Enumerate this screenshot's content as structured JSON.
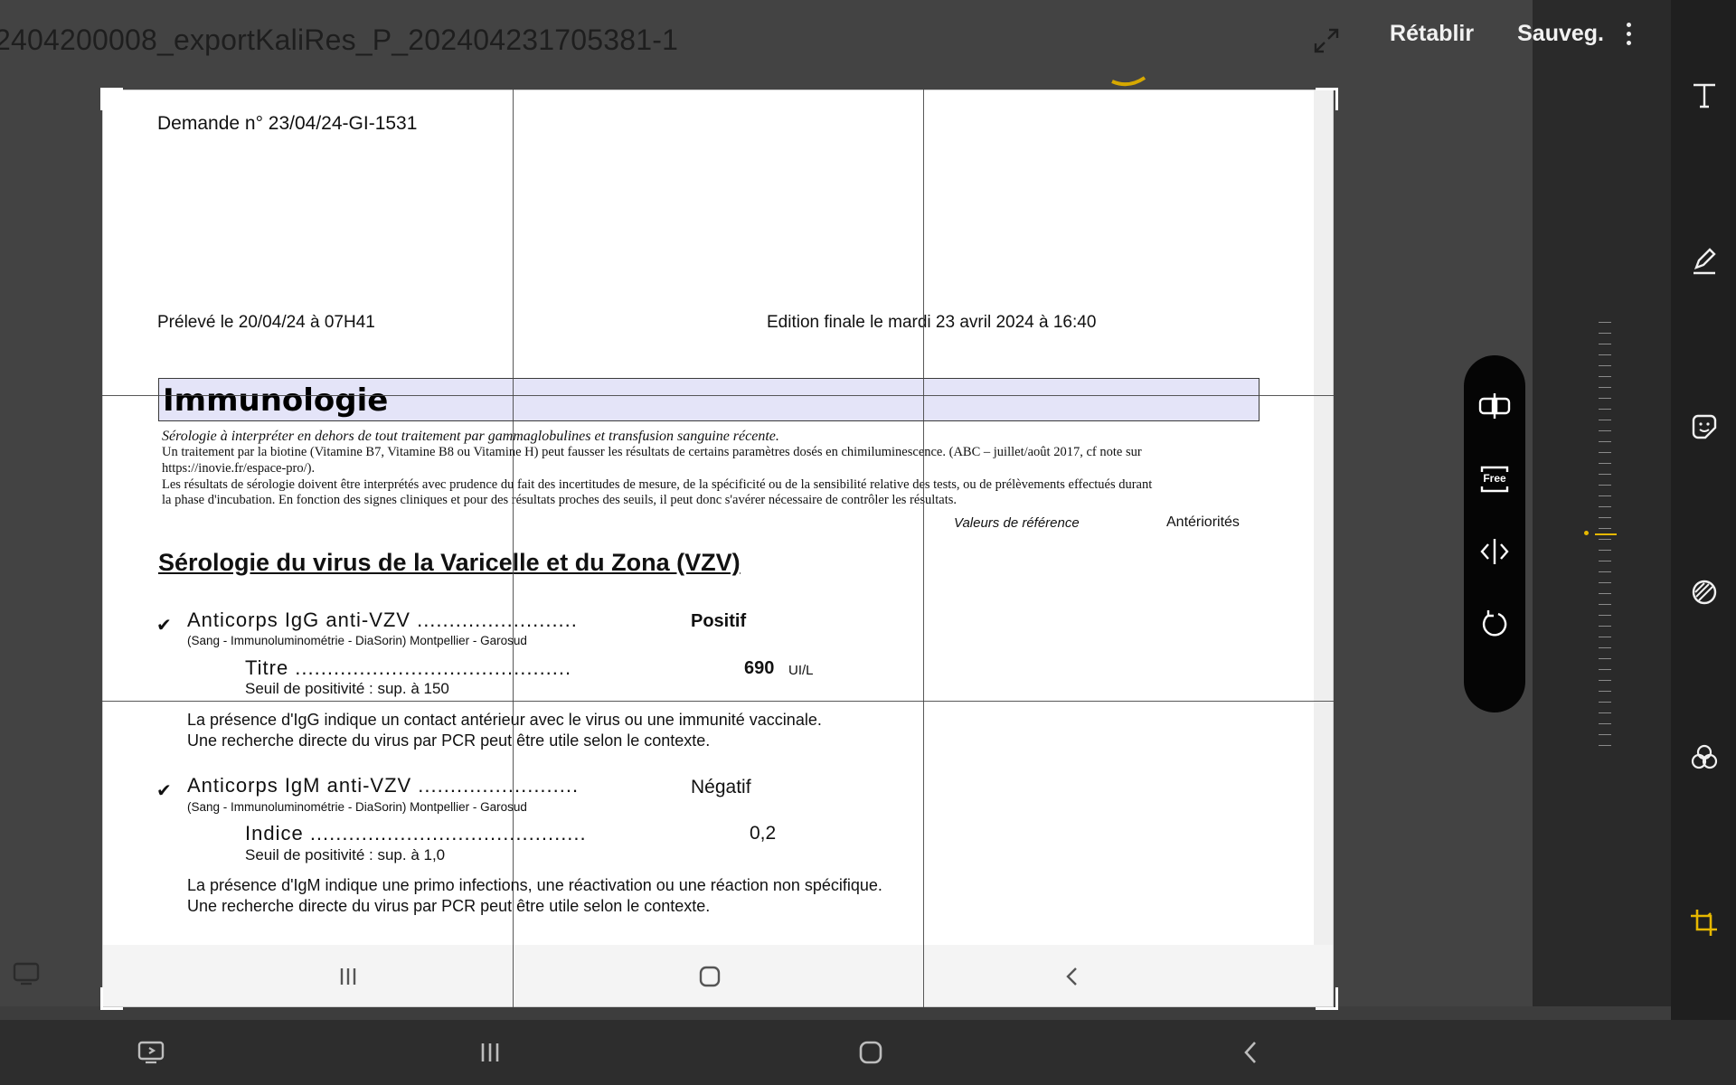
{
  "header": {
    "file_title": "2404200008_exportKaliRes_P_202404231705381-1",
    "restore_label": "Rétablir",
    "save_label": "Sauveg."
  },
  "document": {
    "request_no": "Demande n° 23/04/24-GI-1531",
    "sampled": "Prélevé le 20/04/24 à 07H41",
    "edition": "Edition finale le mardi 23 avril 2024 à 16:40",
    "section": "Immunologie",
    "note_italic": "Sérologie à interpréter en dehors de tout traitement par gammaglobulines et transfusion sanguine récente.",
    "note_line1": "Un traitement par la biotine (Vitamine B7, Vitamine B8 ou Vitamine H) peut fausser les résultats de certains paramètres dosés en chimiluminescence. (ABC – juillet/août 2017, cf note sur",
    "note_line2": "https://inovie.fr/espace-pro/).",
    "note_line3": "Les résultats de sérologie doivent être interprétés avec prudence du fait des incertitudes de mesure, de la spécificité ou de la sensibilité relative des tests, ou de prélèvements effectués durant",
    "note_line4": "la phase d'incubation. En fonction des signes cliniques et pour des résultats proches des seuils, il peut donc s'avérer nécessaire de contrôler les résultats.",
    "col_reference": "Valeurs de référence",
    "col_history": "Antériorités",
    "subsection": "Sérologie du virus de la Varicelle et du Zona (VZV)",
    "igg": {
      "check": "✔",
      "label": "Anticorps IgG anti-VZV .........................",
      "result": "Positif",
      "method": "(Sang - Immunoluminométrie - DiaSorin) Montpellier - Garosud",
      "titre_label": "Titre ...........................................",
      "titre_value": "690",
      "titre_unit": "UI/L",
      "threshold": "Seuil de positivité : sup. à 150",
      "comment1": "La présence d'IgG indique un contact antérieur avec le virus ou une immunité vaccinale.",
      "comment2": "Une recherche directe du virus par PCR peut être utile selon le contexte."
    },
    "igm": {
      "check": "✔",
      "label": "Anticorps IgM anti-VZV .........................",
      "result": "Négatif",
      "method": "(Sang - Immunoluminométrie - DiaSorin) Montpellier - Garosud",
      "index_label": "Indice ...........................................",
      "index_value": "0,2",
      "threshold": "Seuil de positivité : sup. à 1,0",
      "comment1": "La présence d'IgM indique une primo infections, une réactivation ou une réaction non spécifique.",
      "comment2": "Une recherche directe du virus par PCR peut être utile selon le contexte."
    }
  },
  "crop_tools": {
    "free_label": "Free"
  },
  "colors": {
    "accent": "#e6b800",
    "section_bg": "#e4e4f8"
  },
  "icons": [
    "expand-icon",
    "kebab-menu-icon",
    "flip-icon",
    "free-ratio-icon",
    "mirror-icon",
    "rotate-icon",
    "text-icon",
    "pen-icon",
    "sticker-icon",
    "filter-icon",
    "color-icon",
    "crop-icon",
    "recents-icon",
    "home-icon",
    "back-icon",
    "screen-icon"
  ]
}
